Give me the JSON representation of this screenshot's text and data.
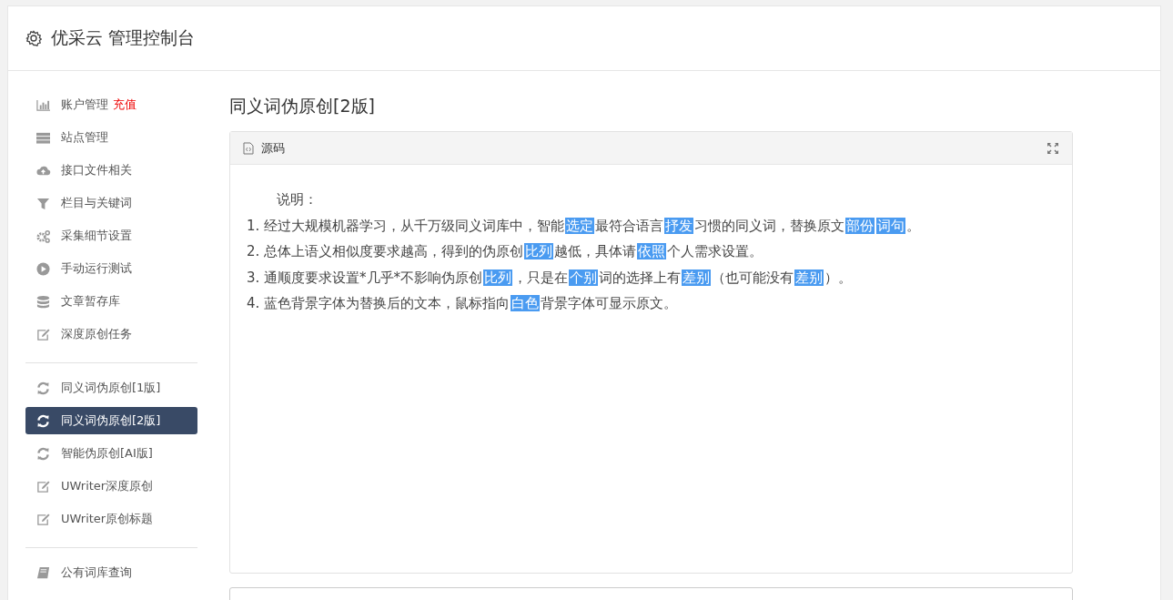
{
  "header": {
    "title": "优采云 管理控制台"
  },
  "sidebar": {
    "groups": [
      {
        "items": [
          {
            "label": "账户管理",
            "badge": "充值",
            "selected": false
          },
          {
            "label": "站点管理",
            "selected": false
          },
          {
            "label": "接口文件相关",
            "selected": false
          },
          {
            "label": "栏目与关键词",
            "selected": false
          },
          {
            "label": "采集细节设置",
            "selected": false
          },
          {
            "label": "手动运行测试",
            "selected": false
          },
          {
            "label": "文章暂存库",
            "selected": false
          },
          {
            "label": "深度原创任务",
            "selected": false
          }
        ]
      },
      {
        "items": [
          {
            "label": "同义词伪原创[1版]",
            "selected": false
          },
          {
            "label": "同义词伪原创[2版]",
            "selected": true
          },
          {
            "label": "智能伪原创[AI版]",
            "selected": false
          },
          {
            "label": "UWriter深度原创",
            "selected": false
          },
          {
            "label": "UWriter原创标题",
            "selected": false
          }
        ]
      },
      {
        "items": [
          {
            "label": "公有词库查询",
            "selected": false
          }
        ]
      }
    ]
  },
  "main": {
    "title": "同义词伪原创[2版]",
    "panel": {
      "tab": "源码",
      "heading": "说明：",
      "lines": [
        [
          {
            "text": "1. 经过大规模机器学习，从千万级同义词库中，智能",
            "highlighted": false
          },
          {
            "text": "选定",
            "highlighted": true
          },
          {
            "text": "最符合语言",
            "highlighted": false
          },
          {
            "text": "抒发",
            "highlighted": true
          },
          {
            "text": "习惯的同义词，替换原文",
            "highlighted": false
          },
          {
            "text": "部份",
            "highlighted": true
          },
          {
            "text": "词句",
            "highlighted": true
          },
          {
            "text": "。",
            "highlighted": false
          }
        ],
        [
          {
            "text": "2. 总体上语义相似度要求越高，得到的伪原创",
            "highlighted": false
          },
          {
            "text": "比列",
            "highlighted": true
          },
          {
            "text": "越低，具体请",
            "highlighted": false
          },
          {
            "text": "依照",
            "highlighted": true
          },
          {
            "text": "个人需求设置。",
            "highlighted": false
          }
        ],
        [
          {
            "text": "3. 通顺度要求设置*几乎*不影响伪原创",
            "highlighted": false
          },
          {
            "text": "比列",
            "highlighted": true
          },
          {
            "text": "，只是在",
            "highlighted": false
          },
          {
            "text": "个别",
            "highlighted": true
          },
          {
            "text": "词的选择上有",
            "highlighted": false
          },
          {
            "text": "差别",
            "highlighted": true
          },
          {
            "text": "（也可能没有",
            "highlighted": false
          },
          {
            "text": "差别",
            "highlighted": true
          },
          {
            "text": "）。",
            "highlighted": false
          }
        ],
        [
          {
            "text": "4. 蓝色背景字体为替换后的文本，鼠标指向",
            "highlighted": false
          },
          {
            "text": "白色",
            "highlighted": true
          },
          {
            "text": "背景字体可显示原文。",
            "highlighted": false
          }
        ]
      ]
    }
  }
}
